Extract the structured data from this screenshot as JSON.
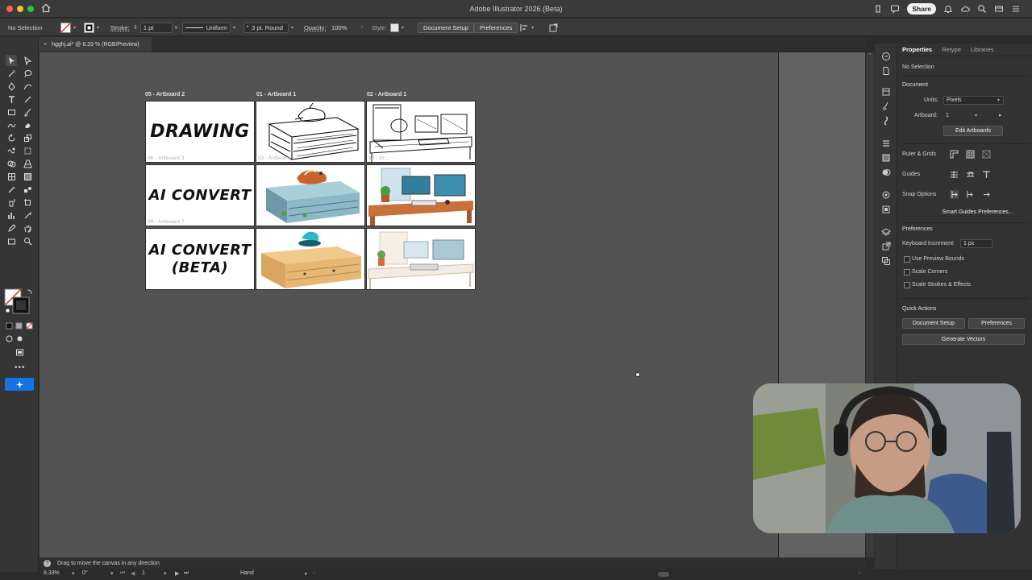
{
  "window": {
    "title": "Adobe Illustrator 2026 (Beta)",
    "share_label": "Share"
  },
  "control_bar": {
    "selection": "No Selection",
    "stroke_label": "Stroke:",
    "stroke_weight": "1 pt",
    "stroke_profile": "Uniform",
    "brush": "3 pt. Round",
    "opacity_label": "Opacity:",
    "opacity_value": "100%",
    "style_label": "Style:",
    "document_setup": "Document Setup",
    "preferences": "Preferences"
  },
  "document_tab": {
    "title": "hgghj.ai* @ 8.33 % (RGB/Preview)"
  },
  "artboards": [
    {
      "label": "05 - Artboard 2",
      "ghost": "06 - Artboard 3",
      "text": "DRAWING"
    },
    {
      "label": "01 - Artboard 1",
      "ghost": "03 - Artboard",
      "text": ""
    },
    {
      "label": "02 - Artboard 1",
      "ghost": "04 - Ar...",
      "text": ""
    },
    {
      "label": "",
      "ghost": "09 - Artboard 7",
      "text": "AI CONVERT"
    },
    {
      "label": "",
      "ghost": "",
      "text": ""
    },
    {
      "label": "",
      "ghost": "",
      "text": ""
    },
    {
      "label": "",
      "ghost": "",
      "text": "AI CONVERT\n(BETA)"
    },
    {
      "label": "",
      "ghost": "",
      "text": ""
    },
    {
      "label": "",
      "ghost": "",
      "text": ""
    }
  ],
  "properties": {
    "tabs": [
      "Properties",
      "Retype",
      "Libraries"
    ],
    "selection": "No Selection",
    "document_title": "Document",
    "units_label": "Units:",
    "units_value": "Pixels",
    "artboard_label": "Artboard:",
    "artboard_value": "1",
    "edit_artboards": "Edit Artboards",
    "ruler_grids": "Ruler & Grids",
    "guides": "Guides",
    "snap_options": "Snap Options",
    "smart_guides": "Smart Guides Preferences...",
    "preferences_title": "Preferences",
    "keyboard_increment_label": "Keyboard Increment:",
    "keyboard_increment_value": "1 px",
    "use_preview_bounds": "Use Preview Bounds",
    "scale_corners": "Scale Corners",
    "scale_strokes": "Scale Strokes & Effects",
    "quick_actions": "Quick Actions",
    "document_setup": "Document Setup",
    "preferences_btn": "Preferences",
    "generate_vectors": "Generate Vectors"
  },
  "status": {
    "hint": "Drag to move the canvas in any direction",
    "zoom": "8.33%",
    "rotation": "0°",
    "artboard_nav": "1",
    "tool": "Hand"
  }
}
